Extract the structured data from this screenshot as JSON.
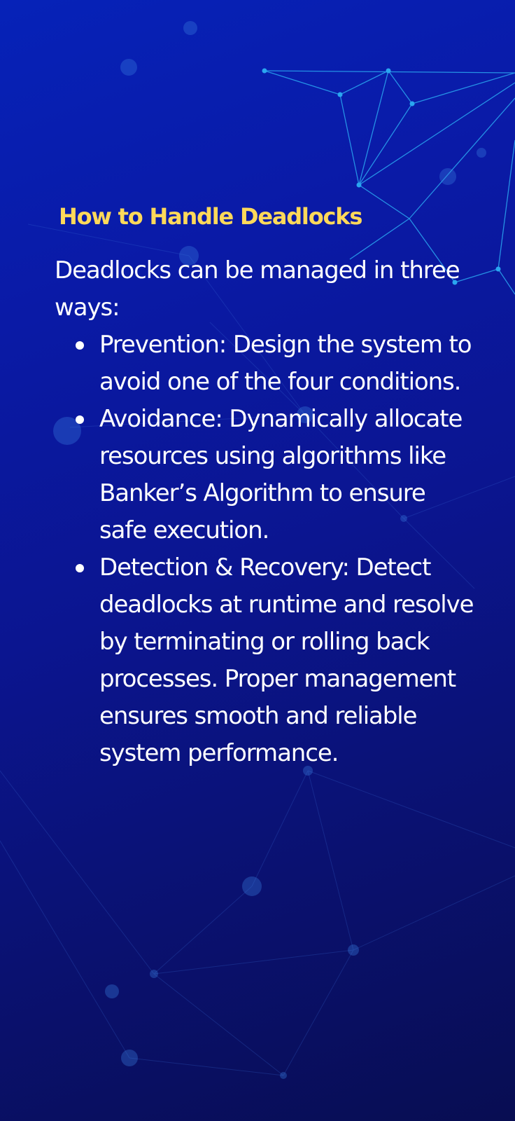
{
  "heading": "How to Handle Deadlocks",
  "intro": "Deadlocks can be managed in three ways:",
  "methods": [
    "Prevention: Design the system to avoid one of the four conditions.",
    "Avoidance: Dynamically allocate resources using algorithms like Banker’s Algorithm to ensure safe execution.",
    "Detection & Recovery: Detect deadlocks at runtime and resolve by terminating or rolling back processes. Proper management ensures smooth and reliable system performance."
  ],
  "colors": {
    "background_start": "#0622b8",
    "background_end": "#080d52",
    "heading": "#ffd95a",
    "text": "#ffffff",
    "network_lines": "#2aa6f0"
  },
  "decorations": {
    "background": "network-graph-pattern"
  }
}
